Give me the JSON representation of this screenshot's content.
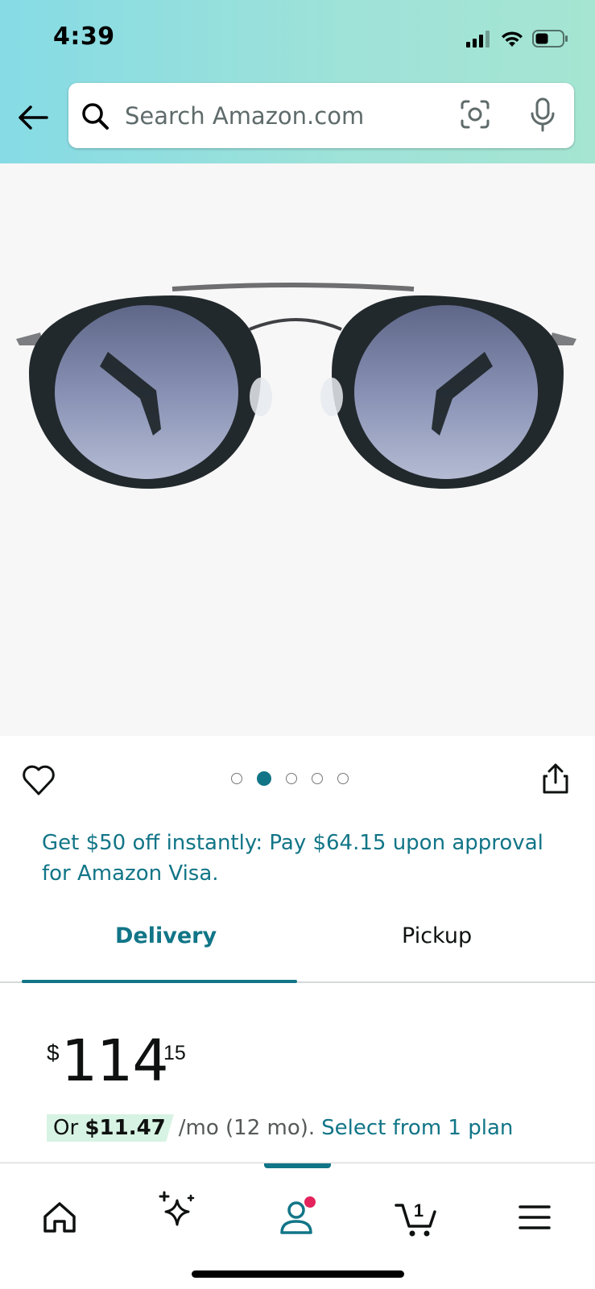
{
  "status_bar": {
    "time": "4:39",
    "icons": [
      "signal-icon",
      "wifi-icon",
      "battery-icon"
    ]
  },
  "search": {
    "placeholder": "Search Amazon.com",
    "icons": [
      "back-arrow-icon",
      "search-icon",
      "camera-icon",
      "microphone-icon"
    ]
  },
  "gallery": {
    "image_count": 5,
    "active_index": 1,
    "icons": [
      "heart-icon",
      "share-icon"
    ]
  },
  "promo": {
    "text": "Get $50 off instantly: Pay $64.15 upon approval for Amazon Visa."
  },
  "tabs": {
    "items": [
      {
        "label": "Delivery",
        "active": true
      },
      {
        "label": "Pickup",
        "active": false
      }
    ]
  },
  "price": {
    "symbol": "$",
    "whole": "114",
    "fraction": "15"
  },
  "installment": {
    "prefix": "Or",
    "amount": "$11.47",
    "terms": "/mo (12 mo).",
    "link": "Select from 1 plan"
  },
  "bottom_nav": {
    "items": [
      "home-icon",
      "ai-sparkle-icon",
      "account-icon",
      "cart-icon",
      "menu-icon"
    ],
    "cart_count": "1",
    "active": "account-icon"
  },
  "colors": {
    "accent": "#117587",
    "header_gradient_start": "#86dbe5",
    "header_gradient_end": "#a5e5d2",
    "notification_dot": "#e3245c",
    "installment_badge_bg": "#d7f3e3"
  }
}
